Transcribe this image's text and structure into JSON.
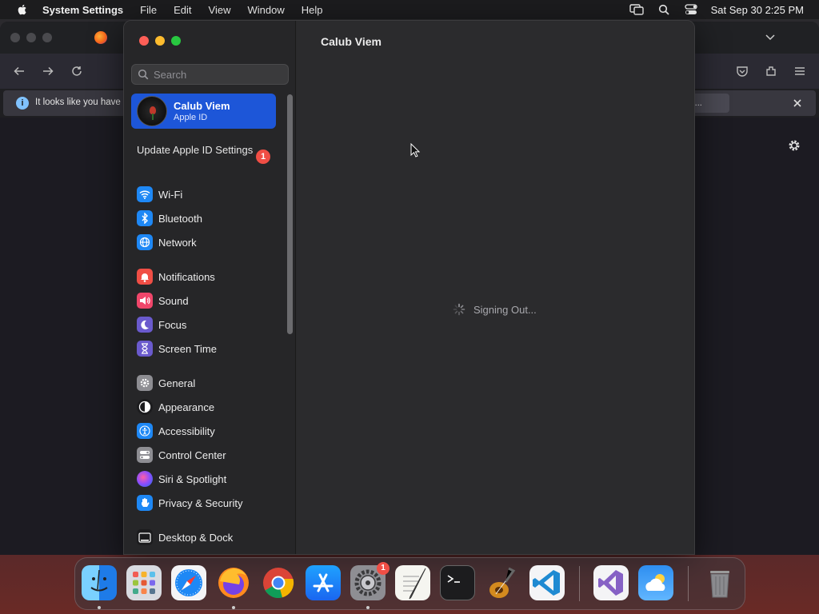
{
  "menubar": {
    "app_name": "System Settings",
    "items": [
      "File",
      "Edit",
      "View",
      "Window",
      "Help"
    ],
    "clock": "Sat Sep 30  2:25 PM"
  },
  "browser": {
    "notice_text": "It looks like you have",
    "notice_button": "fox..."
  },
  "settings": {
    "search_placeholder": "Search",
    "account": {
      "name": "Calub Viem",
      "subtitle": "Apple ID"
    },
    "update": {
      "label": "Update Apple ID Settings",
      "badge": "1"
    },
    "items": [
      {
        "label": "Wi-Fi",
        "icon": "wifi-icon",
        "color": "#1e88f5"
      },
      {
        "label": "Bluetooth",
        "icon": "bluetooth-icon",
        "color": "#1e88f5"
      },
      {
        "label": "Network",
        "icon": "globe-icon",
        "color": "#1e88f5"
      },
      {
        "label": "Notifications",
        "icon": "bell-icon",
        "color": "#f04e45"
      },
      {
        "label": "Sound",
        "icon": "speaker-icon",
        "color": "#f0466a"
      },
      {
        "label": "Focus",
        "icon": "moon-icon",
        "color": "#6a5acd"
      },
      {
        "label": "Screen Time",
        "icon": "hourglass-icon",
        "color": "#6a5acd"
      },
      {
        "label": "General",
        "icon": "gear-icon",
        "color": "#8e8e93"
      },
      {
        "label": "Appearance",
        "icon": "appearance-icon",
        "color": "#1c1c1e"
      },
      {
        "label": "Accessibility",
        "icon": "accessibility-icon",
        "color": "#1e88f5"
      },
      {
        "label": "Control Center",
        "icon": "toggles-icon",
        "color": "#8e8e93"
      },
      {
        "label": "Siri & Spotlight",
        "icon": "siri-icon",
        "color": "#b04ad0"
      },
      {
        "label": "Privacy & Security",
        "icon": "hand-icon",
        "color": "#1e88f5"
      },
      {
        "label": "Desktop & Dock",
        "icon": "dock-icon",
        "color": "#1c1c1e"
      }
    ],
    "content_title": "Calub Viem",
    "status_text": "Signing Out..."
  },
  "dock": {
    "apps": [
      "Finder",
      "Launchpad",
      "Safari",
      "Firefox",
      "Chrome",
      "App Store",
      "System Settings",
      "TextEdit",
      "Terminal",
      "GarageBand",
      "Visual Studio Code",
      "Visual Studio",
      "Weather",
      "Trash"
    ],
    "settings_badge": "1"
  }
}
